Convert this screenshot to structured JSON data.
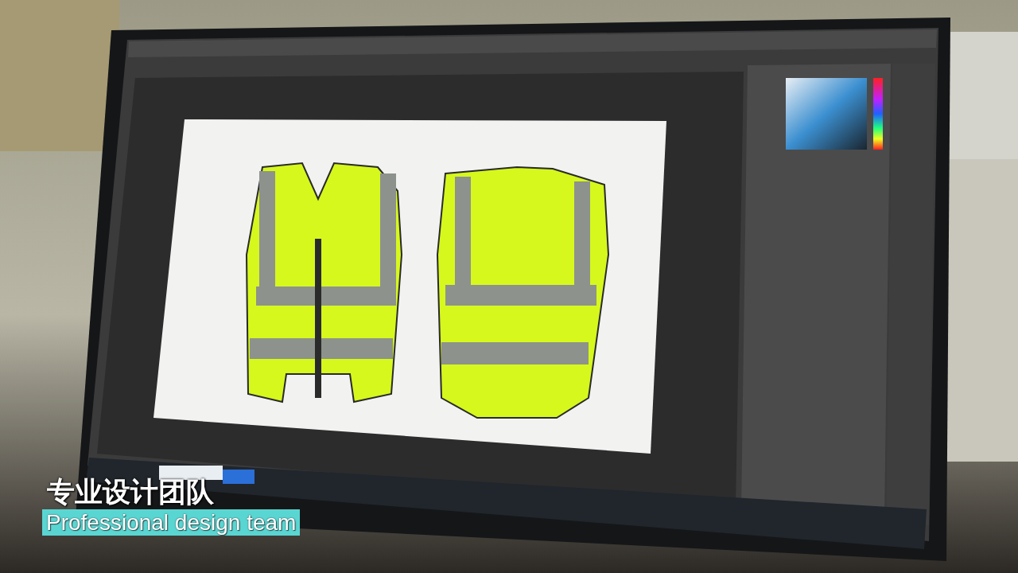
{
  "caption": {
    "title": "专业设计团队",
    "subtitle": "Professional design team"
  }
}
